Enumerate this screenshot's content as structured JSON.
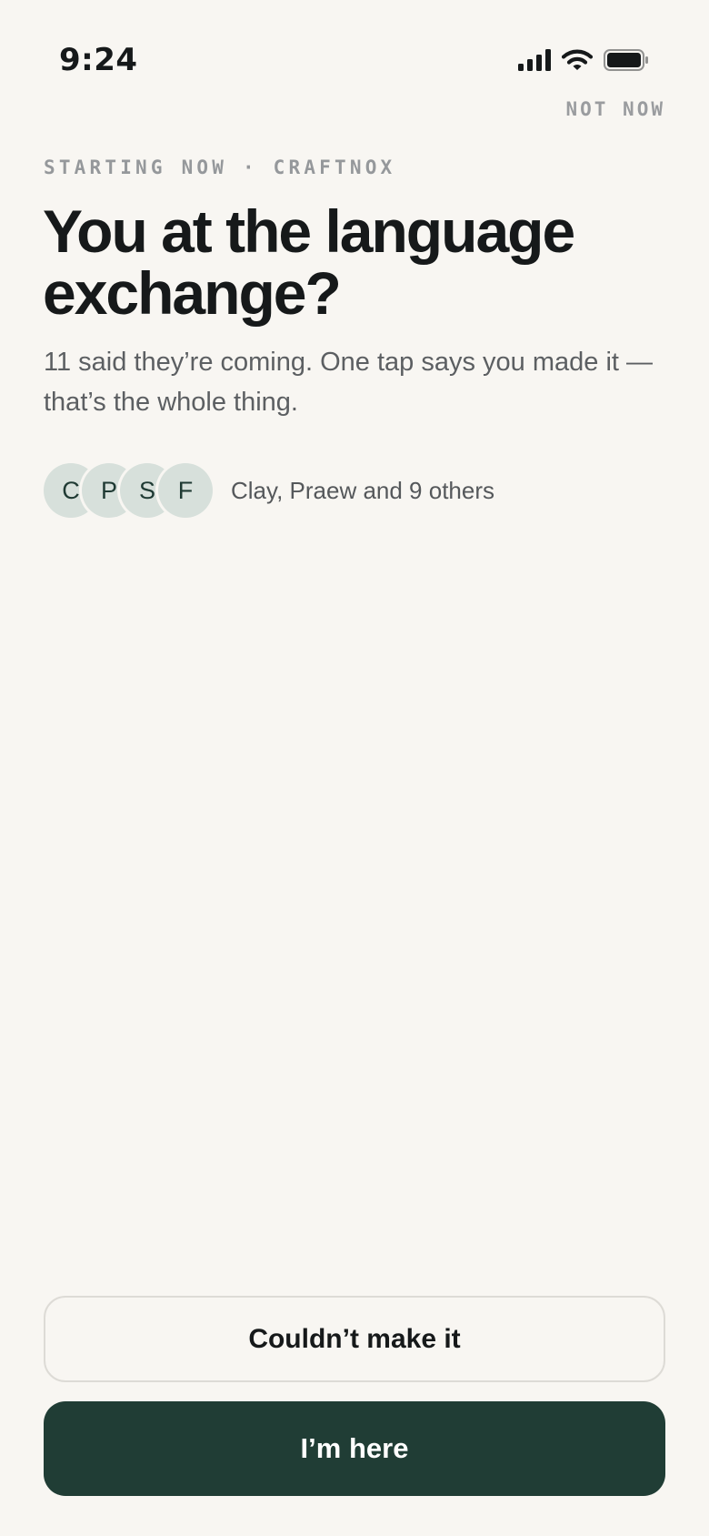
{
  "status_bar": {
    "time": "9:24",
    "icons": [
      "cellular-signal-icon",
      "wifi-icon",
      "battery-icon"
    ]
  },
  "header": {
    "dismiss_label": "NOT NOW"
  },
  "main": {
    "eyebrow": "STARTING NOW · CRAFTNOX",
    "title": "You at the language exchange?",
    "subtitle": "11 said they’re coming. One tap says you made it — that’s the whole thing.",
    "attendees": {
      "avatars": [
        {
          "initial": "C"
        },
        {
          "initial": "P"
        },
        {
          "initial": "S"
        },
        {
          "initial": "F"
        }
      ],
      "summary": "Clay, Praew and 9 others"
    }
  },
  "actions": {
    "secondary_label": "Couldn’t make it",
    "primary_label": "I’m here"
  },
  "colors": {
    "background": "#f8f6f2",
    "primary_button": "#203d35",
    "avatar_bg": "#d7e0db",
    "text_primary": "#16191a",
    "text_muted": "#95989b"
  }
}
